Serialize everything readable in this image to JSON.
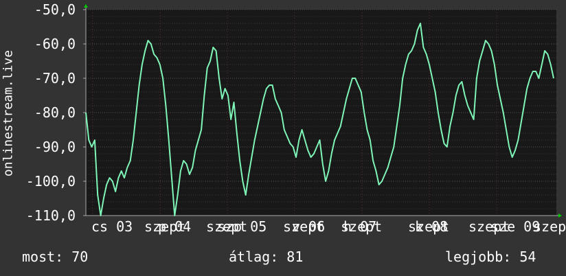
{
  "chart_data": {
    "type": "line",
    "ylabel": "onlinestream.live",
    "ylim": [
      -110,
      -50
    ],
    "y_ticks": [
      "-50,0",
      "-60,0",
      "-70,0",
      "-80,0",
      "-90,0",
      "-100,0",
      "-110,0"
    ],
    "x_ticks": [
      "cs 03",
      "szept",
      "p 04",
      "szept",
      "szo 05",
      "szept",
      "v 06",
      "szept",
      "h 07",
      "szept",
      "k 08",
      "szept",
      "sze 09",
      "szept"
    ],
    "grid": true,
    "colors": {
      "background": "#333333",
      "plot": "#181818",
      "line": "#7ff6b8",
      "grid": "#555555",
      "axis_arrow": "#00cc00",
      "text": "#ffffff"
    },
    "series": [
      {
        "values": [
          -80,
          -88,
          -90,
          -88,
          -104,
          -110,
          -105,
          -101,
          -99,
          -100,
          -103,
          -99,
          -97,
          -99,
          -96,
          -94,
          -88,
          -80,
          -72,
          -66,
          -62,
          -59,
          -60,
          -63,
          -64,
          -66,
          -70,
          -78,
          -88,
          -99,
          -110,
          -104,
          -97,
          -94,
          -95,
          -98,
          -96,
          -91,
          -88,
          -85,
          -75,
          -67,
          -65,
          -61,
          -62,
          -70,
          -76,
          -73,
          -75,
          -82,
          -77,
          -86,
          -94,
          -100,
          -104,
          -98,
          -93,
          -88,
          -84,
          -80,
          -76,
          -73,
          -72,
          -72,
          -76,
          -78,
          -80,
          -85,
          -87,
          -89,
          -90,
          -93,
          -88,
          -85,
          -88,
          -91,
          -93,
          -92,
          -90,
          -88,
          -95,
          -100,
          -97,
          -92,
          -88,
          -86,
          -84,
          -80,
          -76,
          -73,
          -70,
          -70,
          -72,
          -74,
          -80,
          -85,
          -88,
          -94,
          -97,
          -101,
          -100,
          -98,
          -96,
          -93,
          -90,
          -84,
          -78,
          -70,
          -66,
          -63,
          -62,
          -60,
          -56,
          -54,
          -61,
          -63,
          -66,
          -70,
          -74,
          -80,
          -85,
          -89,
          -90,
          -84,
          -80,
          -75,
          -72,
          -71,
          -75,
          -78,
          -80,
          -82,
          -70,
          -65,
          -62,
          -59,
          -60,
          -62,
          -66,
          -72,
          -76,
          -80,
          -85,
          -90,
          -93,
          -91,
          -88,
          -83,
          -78,
          -73,
          -70,
          -68,
          -68,
          -70,
          -66,
          -62,
          -63,
          -66,
          -70
        ]
      }
    ]
  },
  "stats": {
    "current": "most: 70",
    "average": "átlag: 81",
    "best": "legjobb: 54"
  }
}
